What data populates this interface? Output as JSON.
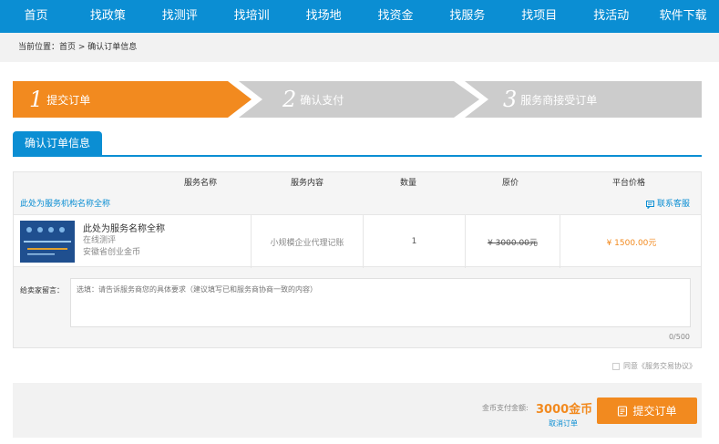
{
  "nav": {
    "items": [
      "首页",
      "找政策",
      "找测评",
      "找培训",
      "找场地",
      "找资金",
      "找服务",
      "找项目",
      "找活动",
      "软件下载"
    ]
  },
  "breadcrumb": {
    "prefix": "当前位置：",
    "home": "首页",
    "separator": " > ",
    "current": "确认订单信息"
  },
  "steps": [
    {
      "num": "1",
      "label": "提交订单",
      "state": "active"
    },
    {
      "num": "2",
      "label": "确认支付",
      "state": "inactive"
    },
    {
      "num": "3",
      "label": "服务商接受订单",
      "state": "inactive"
    }
  ],
  "section_tab": "确认订单信息",
  "table": {
    "headers": [
      "服务名称",
      "服务内容",
      "数量",
      "原价",
      "平台价格"
    ],
    "org_name": "此处为服务机构名称全称",
    "contact": "联系客服"
  },
  "item": {
    "name": "此处为服务名称全称",
    "type": "在线测评",
    "provider": "安徽省创业金币",
    "content": "小规模企业代理记账",
    "quantity": "1",
    "original_price": "¥ 3000.00元",
    "platform_price": "¥ 1500.00元",
    "thumb_text": "Mobile"
  },
  "message": {
    "label": "给卖家留言：",
    "placeholder": "选填：请告诉服务商您的具体要求（建议填写已和服务商协商一致的内容）",
    "counter": "0/500"
  },
  "agreement": "同意《服务交易协议》",
  "footer": {
    "pay_label": "金币支付金额:",
    "pay_amount": "3000金币",
    "cancel": "取消订单",
    "submit": "提交订单"
  },
  "colors": {
    "primary": "#0b8ed3",
    "accent": "#f28a1f",
    "step_inactive": "#cccccc"
  }
}
